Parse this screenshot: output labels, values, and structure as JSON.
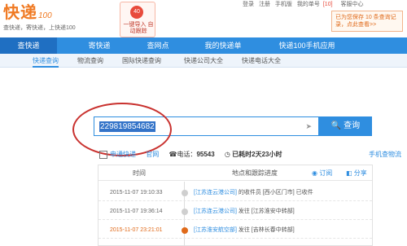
{
  "logo": {
    "name": "快递",
    "badge": "100",
    "slogan": "查快递，寄快递，上快递100"
  },
  "promo": {
    "badge": "40",
    "text": "一键导入 自动跟踪"
  },
  "toplinks": {
    "login": "登录",
    "register": "注册",
    "mobile": "手机版",
    "my_orders": "我的单号",
    "count": "[10]",
    "support": "客服中心"
  },
  "notice": "已为您保存 10 条查询记录，点此查看>>",
  "nav": {
    "items": [
      {
        "label": "查快递",
        "active": true
      },
      {
        "label": "寄快递"
      },
      {
        "label": "查网点"
      },
      {
        "label": "我的快递单"
      },
      {
        "label": "快递100手机应用"
      }
    ]
  },
  "subnav": {
    "items": [
      {
        "label": "快递查询",
        "active": true
      },
      {
        "label": "物流查询"
      },
      {
        "label": "国际快递查询"
      },
      {
        "label": "快递公司大全"
      },
      {
        "label": "快递电话大全"
      }
    ]
  },
  "search": {
    "value": "229819854682",
    "button": "查询"
  },
  "company": {
    "name": "申通快递",
    "site": "官网",
    "phone_label": "电话：",
    "phone": "95543",
    "elapsed": "已耗时2天23小时",
    "mobile_link": "手机查物流"
  },
  "table": {
    "col_time": "时间",
    "col_loc": "地点和跟踪进度",
    "subscribe": "订阅",
    "share": "分享",
    "rows": [
      {
        "time": "2015-11-07 19:10:33",
        "loc": "[江苏连云港公司]",
        "detail": " 的收件员 [西小区门市] 已收件"
      },
      {
        "time": "2015-11-07 19:36:14",
        "loc": "[江苏连云港公司]",
        "detail": " 发往 [江苏淮安中转部]"
      },
      {
        "time": "2015-11-07 23:21:01",
        "loc": "[江苏淮安航空部]",
        "detail": " 发往 [吉林长春中转部]"
      }
    ]
  },
  "colors": {
    "nav": "#2f8ee0",
    "accent": "#f07a23",
    "highlight": "#c9322f"
  }
}
